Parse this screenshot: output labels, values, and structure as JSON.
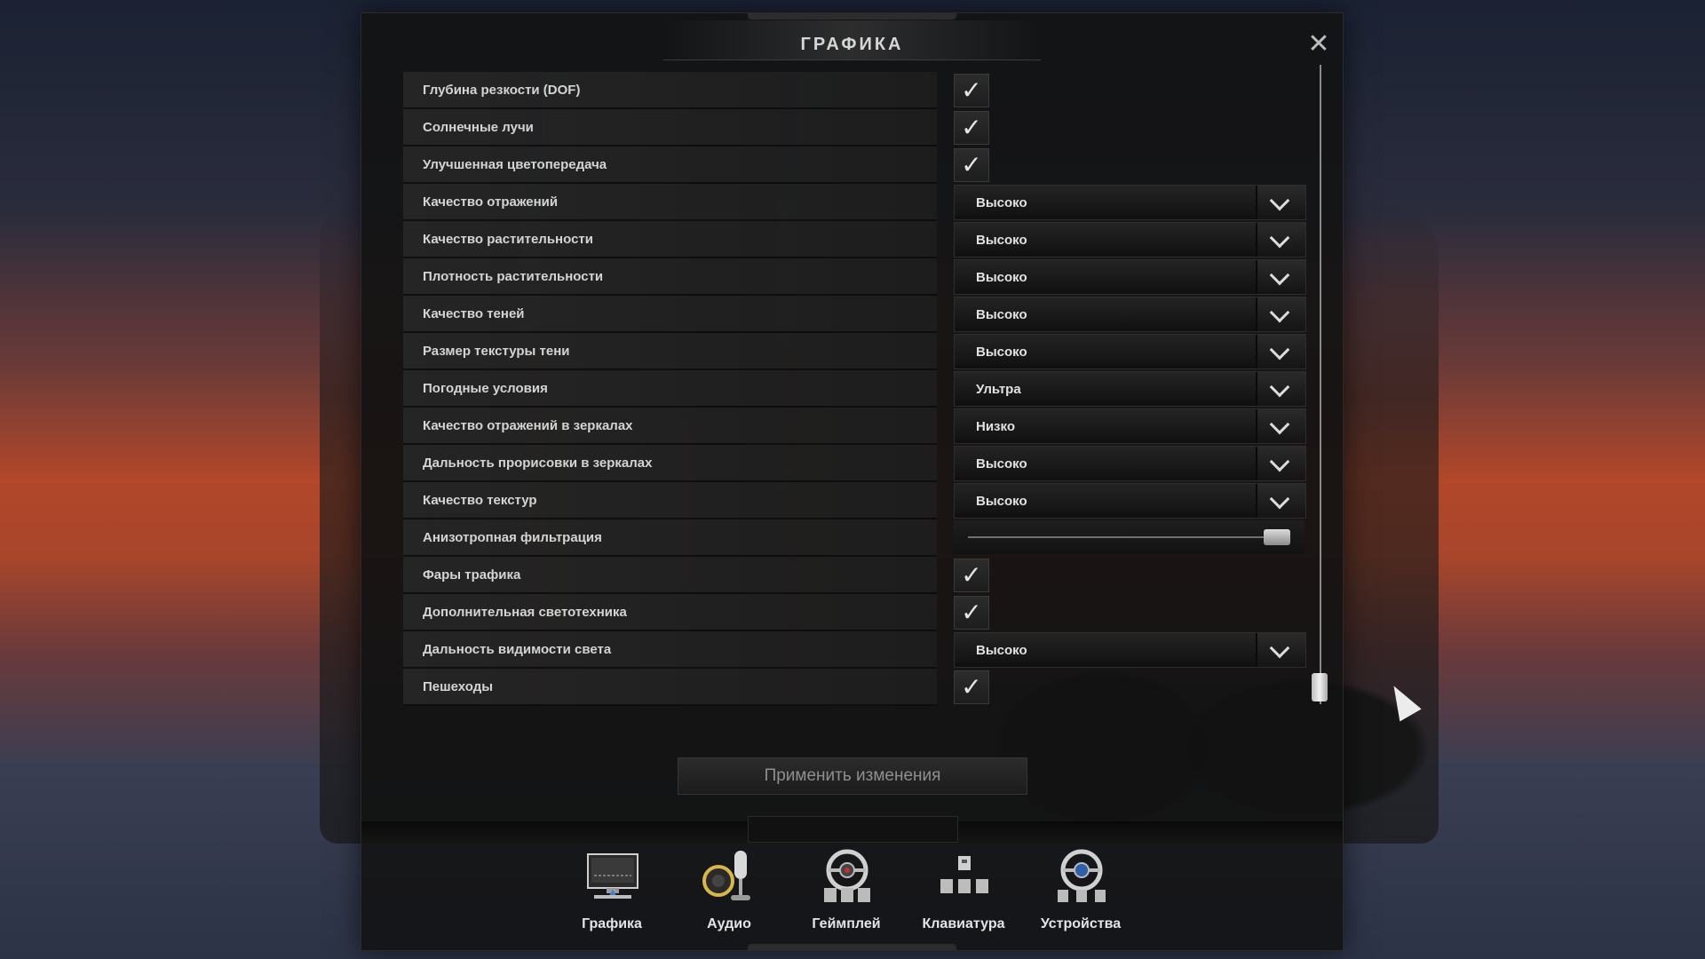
{
  "dialog": {
    "title": "ГРАФИКА",
    "close_glyph": "✕"
  },
  "settings": [
    {
      "label": "Глубина резкости (DOF)",
      "type": "checkbox",
      "checked": true
    },
    {
      "label": "Солнечные лучи",
      "type": "checkbox",
      "checked": true
    },
    {
      "label": "Улучшенная цветопередача",
      "type": "checkbox",
      "checked": true
    },
    {
      "label": "Качество отражений",
      "type": "select",
      "value": "Высоко"
    },
    {
      "label": "Качество растительности",
      "type": "select",
      "value": "Высоко"
    },
    {
      "label": "Плотность растительности",
      "type": "select",
      "value": "Высоко"
    },
    {
      "label": "Качество теней",
      "type": "select",
      "value": "Высоко"
    },
    {
      "label": "Размер текстуры тени",
      "type": "select",
      "value": "Высоко"
    },
    {
      "label": "Погодные условия",
      "type": "select",
      "value": "Ультра"
    },
    {
      "label": "Качество отражений в зеркалах",
      "type": "select",
      "value": "Низко"
    },
    {
      "label": "Дальность прорисовки в зеркалах",
      "type": "select",
      "value": "Высоко"
    },
    {
      "label": "Качество текстур",
      "type": "select",
      "value": "Высоко"
    },
    {
      "label": "Анизотропная фильтрация",
      "type": "slider",
      "value": 1.0
    },
    {
      "label": "Фары трафика",
      "type": "checkbox",
      "checked": true
    },
    {
      "label": "Дополнительная светотехника",
      "type": "checkbox",
      "checked": true
    },
    {
      "label": "Дальность видимости света",
      "type": "select",
      "value": "Высоко"
    },
    {
      "label": "Пешеходы",
      "type": "checkbox",
      "checked": true
    }
  ],
  "checkmark_glyph": "✓",
  "apply_button": "Применить изменения",
  "tabs": [
    {
      "label": "Графика",
      "icon": "monitor-icon"
    },
    {
      "label": "Аудио",
      "icon": "microphone-speaker-icon"
    },
    {
      "label": "Геймплей",
      "icon": "steering-wheel-icon"
    },
    {
      "label": "Клавиатура",
      "icon": "keyboard-keys-icon"
    },
    {
      "label": "Устройства",
      "icon": "wheel-pedals-icon"
    }
  ],
  "colors": {
    "panel_bg": "#121212",
    "text": "#d4d4d4",
    "apply_text": "#8f8f8f"
  }
}
